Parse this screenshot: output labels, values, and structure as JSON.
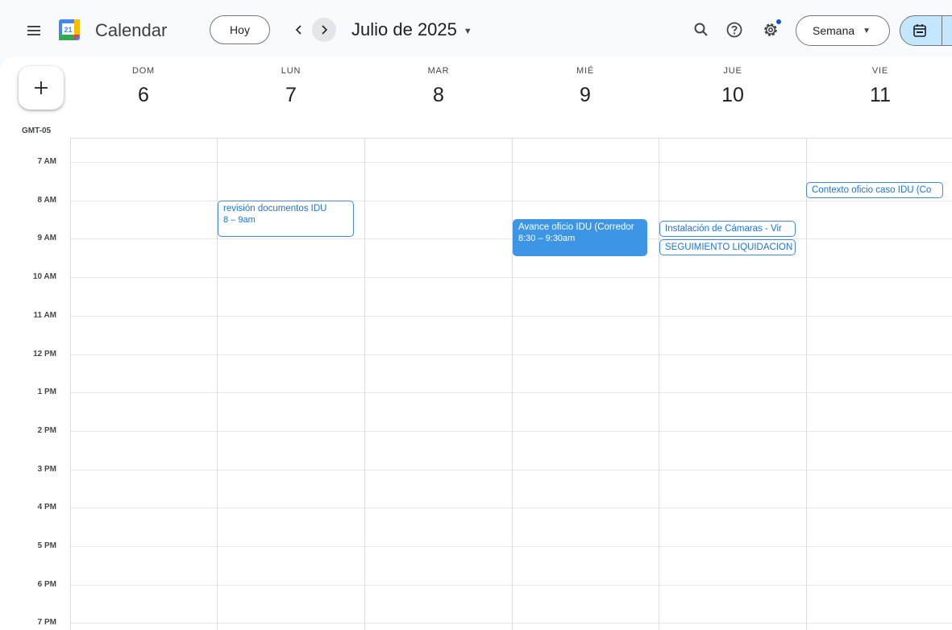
{
  "header": {
    "app_title": "Calendar",
    "logo_day": "21",
    "today_label": "Hoy",
    "month_title": "Julio de 2025",
    "view_label": "Semana"
  },
  "week": {
    "timezone": "GMT-05",
    "days": [
      {
        "name": "DOM",
        "number": "6"
      },
      {
        "name": "LUN",
        "number": "7"
      },
      {
        "name": "MAR",
        "number": "8"
      },
      {
        "name": "MIÉ",
        "number": "9"
      },
      {
        "name": "JUE",
        "number": "10"
      },
      {
        "name": "VIE",
        "number": "11"
      }
    ],
    "hours": [
      "7 AM",
      "8 AM",
      "9 AM",
      "10 AM",
      "11 AM",
      "12 PM",
      "1 PM",
      "2 PM",
      "3 PM",
      "4 PM",
      "5 PM",
      "6 PM",
      "7 PM"
    ]
  },
  "events": [
    {
      "title": "revisión documentos IDU",
      "time": "8 – 9am",
      "day": "LUN"
    },
    {
      "title": "Avance oficio IDU (Corredor",
      "time": "8:30 – 9:30am",
      "day": "MIÉ"
    },
    {
      "title": "Instalación de Cámaras - Vir",
      "day": "JUE"
    },
    {
      "title": "SEGUIMIENTO LIQUIDACION",
      "day": "JUE"
    },
    {
      "title": "Contexto oficio caso IDU (Co",
      "day": "VIE"
    }
  ],
  "colors": {
    "accent": "#1a73e8",
    "event_filled": "#3d96e5",
    "mode_toggle": "#c2e7ff"
  }
}
